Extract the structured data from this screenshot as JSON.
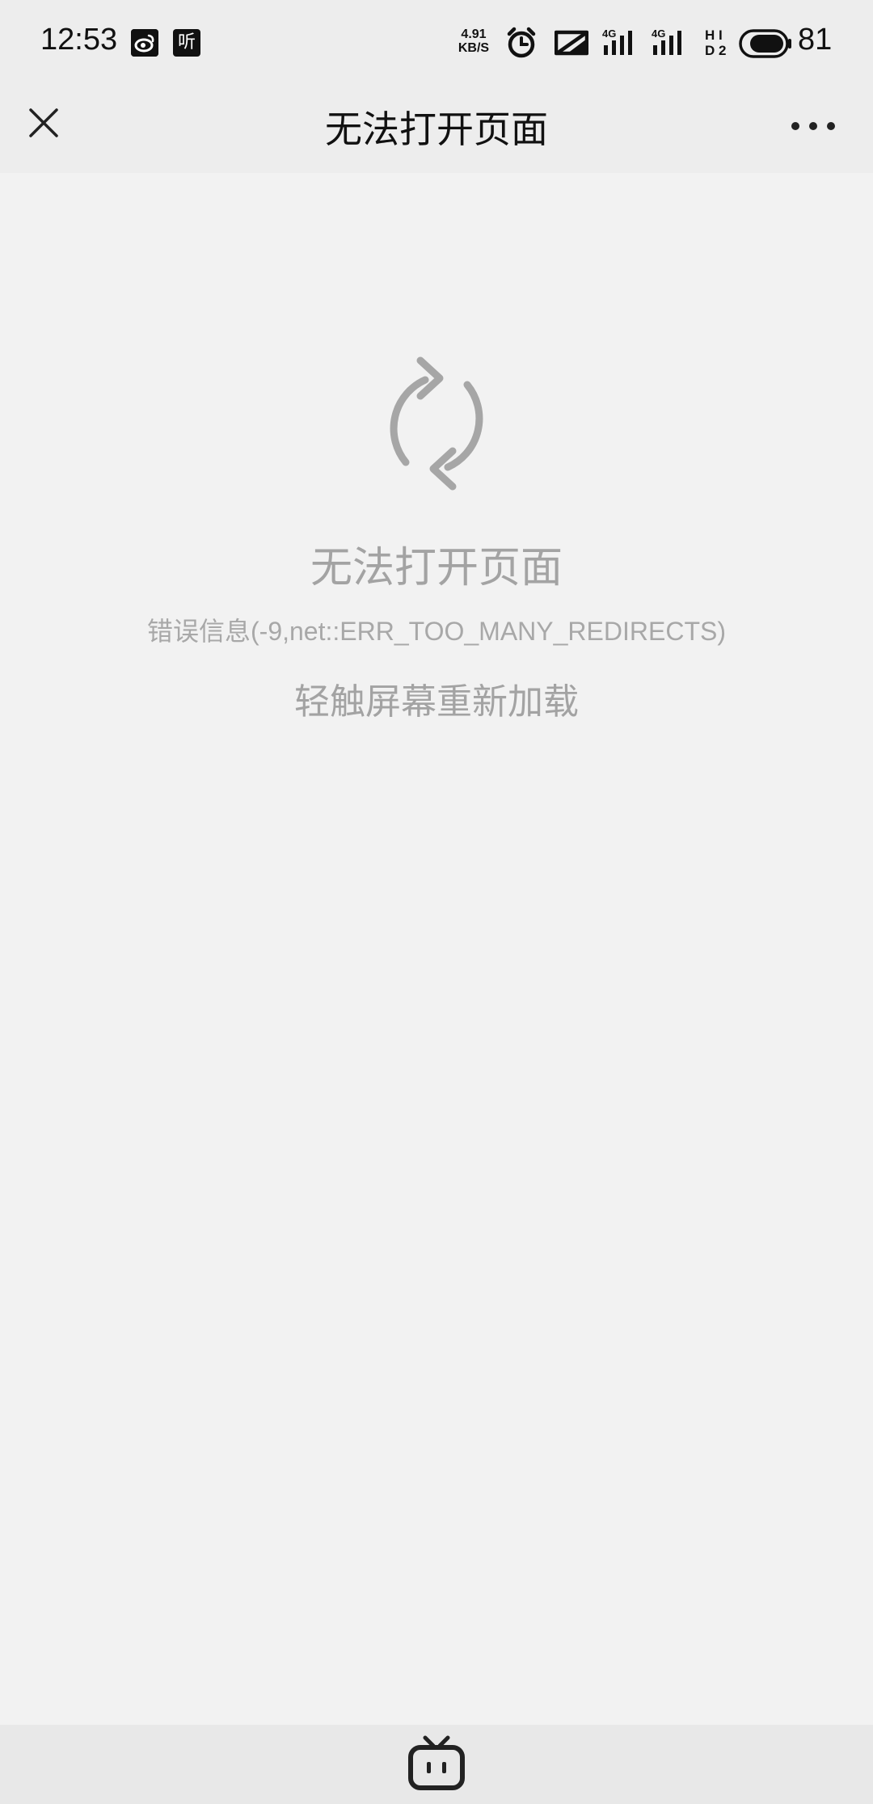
{
  "status_bar": {
    "time": "12:53",
    "app_icons": [
      "weibo-icon",
      "ting-icon"
    ],
    "ting_label": "听",
    "net_speed_value": "4.91",
    "net_speed_unit": "KB/S",
    "signal_1_label": "4G",
    "signal_2_label": "4G",
    "hd_label_top": "H I",
    "hd_label_bottom": "D 2",
    "battery": "81"
  },
  "nav": {
    "title": "无法打开页面",
    "close_icon": "close-icon",
    "more_icon": "more-icon"
  },
  "error": {
    "icon": "reload-icon",
    "title": "无法打开页面",
    "detail": "错误信息(-9,net::ERR_TOO_MANY_REDIRECTS)",
    "reload_hint": "轻触屏幕重新加载"
  },
  "bottom": {
    "icon": "bilibili-tv-icon"
  }
}
